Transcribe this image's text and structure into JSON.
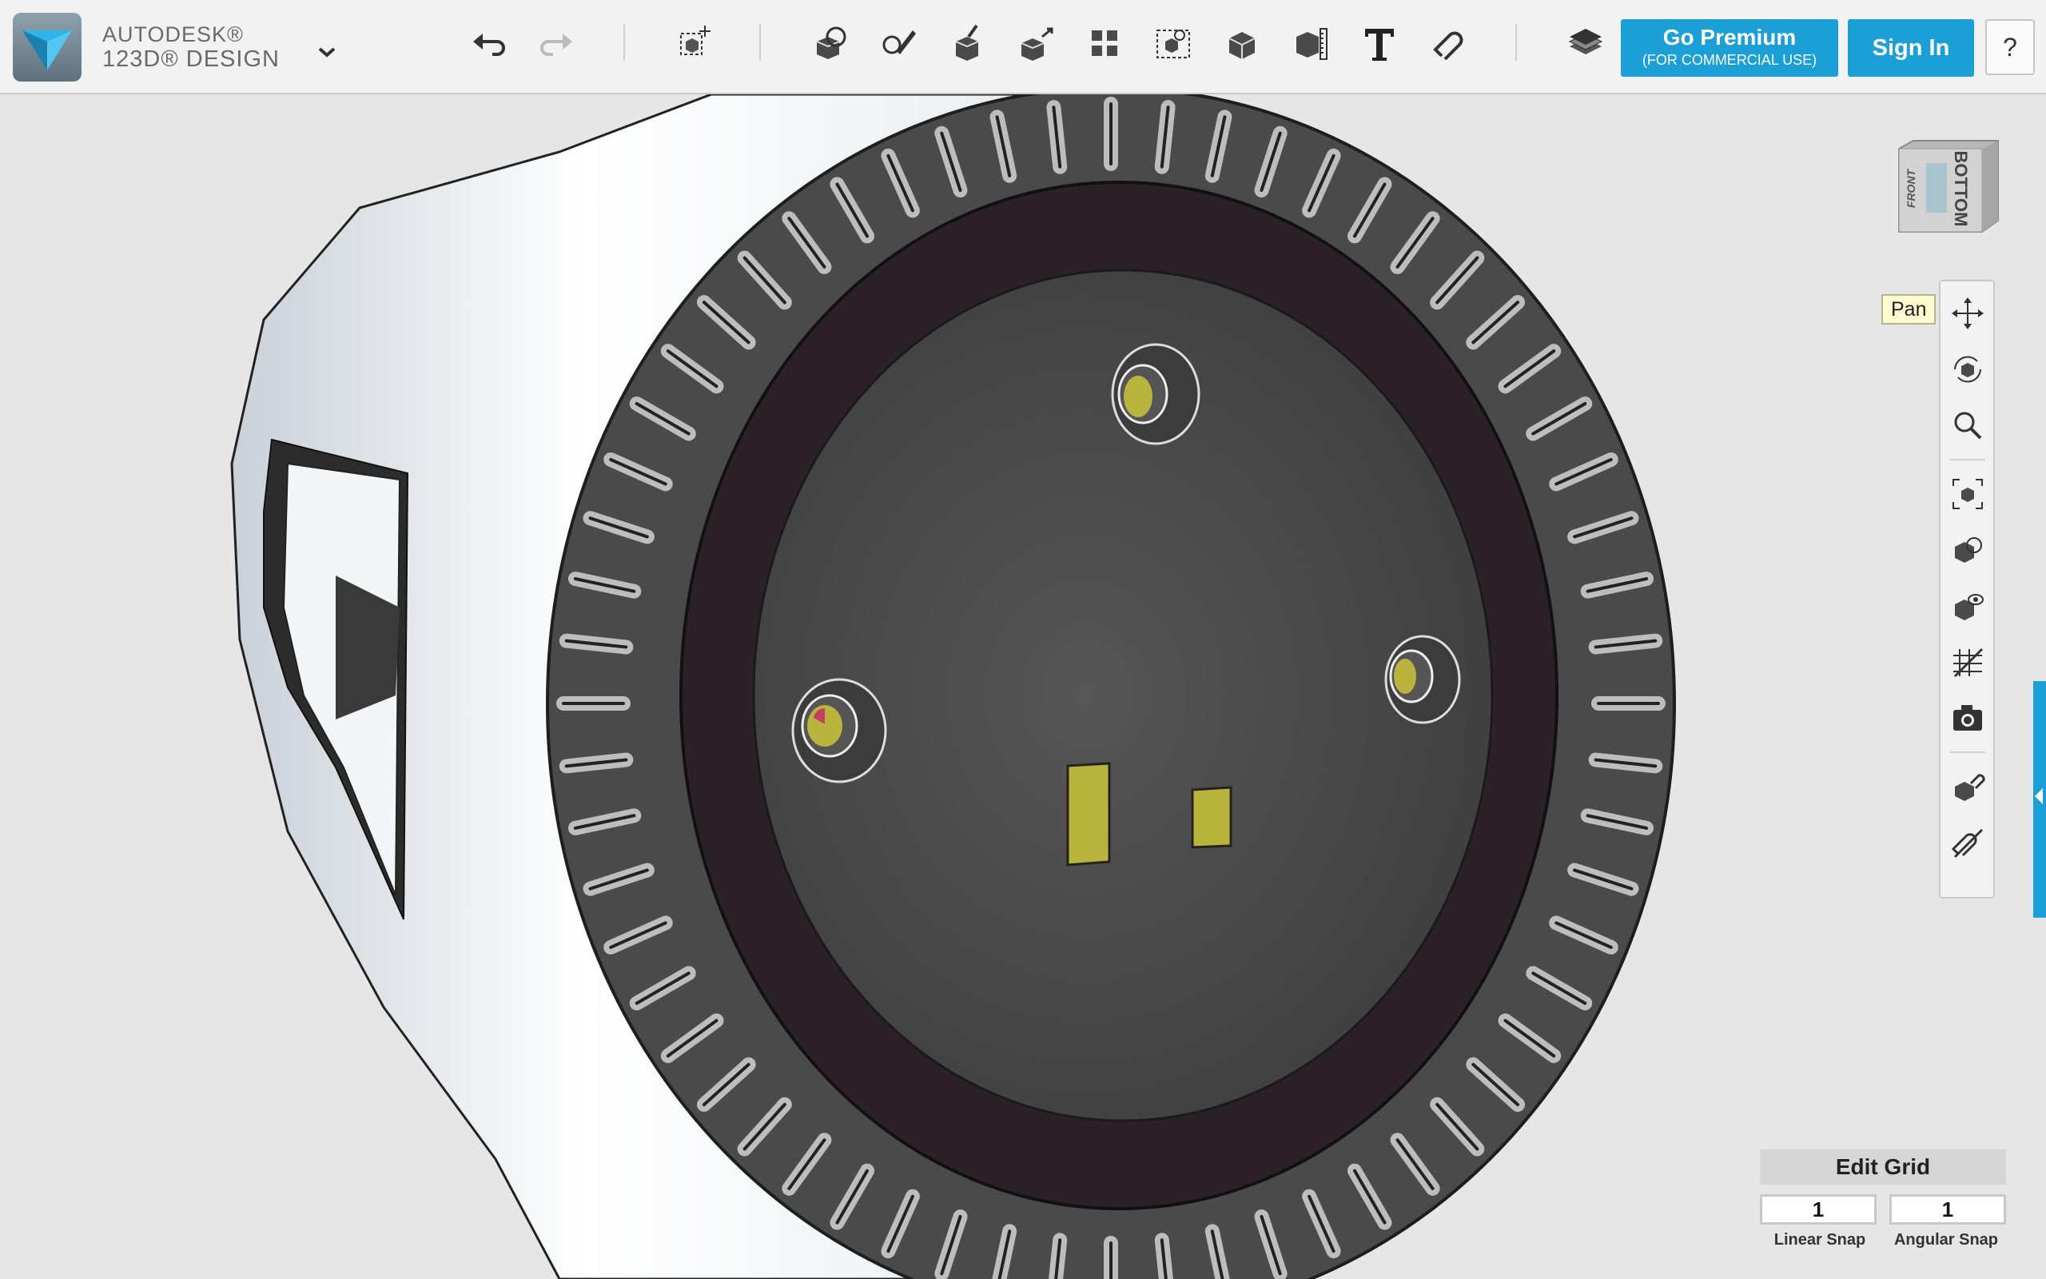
{
  "brand": {
    "line1": "AUTODESK®",
    "line2": "123D® DESIGN"
  },
  "toolbar": {
    "tools": [
      {
        "name": "undo-icon"
      },
      {
        "name": "redo-icon"
      },
      {
        "name": "transform-icon"
      },
      {
        "name": "primitives-icon"
      },
      {
        "name": "sketch-icon"
      },
      {
        "name": "construct-icon"
      },
      {
        "name": "modify-icon"
      },
      {
        "name": "pattern-icon"
      },
      {
        "name": "grouping-icon"
      },
      {
        "name": "combine-icon"
      },
      {
        "name": "measure-icon"
      },
      {
        "name": "text-icon"
      },
      {
        "name": "snap-icon"
      },
      {
        "name": "materials-icon"
      }
    ],
    "premium_line1": "Go Premium",
    "premium_line2": "(FOR COMMERCIAL USE)",
    "signin_label": "Sign In",
    "help_label": "?"
  },
  "viewcube": {
    "face_top": "BOTTOM",
    "face_side": "FRONT"
  },
  "navigation": {
    "tooltip": "Pan",
    "tools": [
      {
        "name": "pan-icon"
      },
      {
        "name": "orbit-icon"
      },
      {
        "name": "zoom-icon"
      },
      {
        "name": "fit-icon"
      },
      {
        "name": "view-mode-icon"
      },
      {
        "name": "show-hide-icon"
      },
      {
        "name": "grid-visibility-icon"
      },
      {
        "name": "screenshot-icon"
      },
      {
        "name": "snap-tool-icon"
      },
      {
        "name": "materials-outline-icon"
      }
    ]
  },
  "edit_grid": {
    "title": "Edit Grid",
    "linear_snap_value": "1",
    "angular_snap_value": "1",
    "linear_snap_label": "Linear Snap",
    "angular_snap_label": "Angular Snap"
  },
  "colors": {
    "accent": "#1a9fd6",
    "model_body": "#4d4d4d",
    "model_ring": "#2d2129",
    "highlight": "#b9b43b"
  }
}
